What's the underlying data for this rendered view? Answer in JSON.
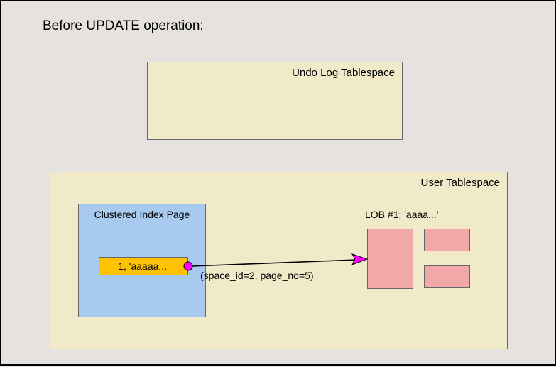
{
  "title": "Before UPDATE operation:",
  "undo": {
    "label": "Undo Log Tablespace"
  },
  "user": {
    "label": "User Tablespace",
    "index_page": {
      "label": "Clustered Index Page",
      "row": "1, 'aaaaa...'"
    },
    "pointer_label": "(space_id=2, page_no=5)",
    "lob": {
      "label": "LOB #1: 'aaaa...'"
    }
  }
}
